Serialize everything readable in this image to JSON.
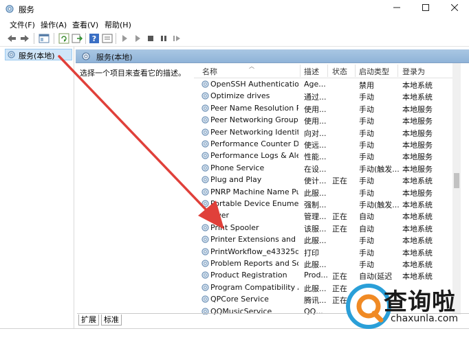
{
  "window": {
    "title": "服务"
  },
  "menu": [
    "文件(F)",
    "操作(A)",
    "查看(V)",
    "帮助(H)"
  ],
  "tree": {
    "root_label": "服务(本地)"
  },
  "panel": {
    "header": "服务(本地)",
    "description_prompt": "选择一个项目来查看它的描述。"
  },
  "columns": [
    "名称",
    "描述",
    "状态",
    "启动类型",
    "登录为"
  ],
  "services": [
    {
      "name": "OpenSSH Authentication ...",
      "desc": "Age...",
      "status": "",
      "startup": "禁用",
      "logon": "本地系统"
    },
    {
      "name": "Optimize drives",
      "desc": "通过...",
      "status": "",
      "startup": "手动",
      "logon": "本地系统"
    },
    {
      "name": "Peer Name Resolution Pr...",
      "desc": "使用...",
      "status": "",
      "startup": "手动",
      "logon": "本地服务"
    },
    {
      "name": "Peer Networking Groupi",
      "desc": "使用...",
      "status": "",
      "startup": "手动",
      "logon": "本地服务"
    },
    {
      "name": "Peer Networking Identity...",
      "desc": "向对...",
      "status": "",
      "startup": "手动",
      "logon": "本地服务"
    },
    {
      "name": "Performance Counter DL...",
      "desc": "使远...",
      "status": "",
      "startup": "手动",
      "logon": "本地服务"
    },
    {
      "name": "Performance Logs & Aler",
      "desc": "性能...",
      "status": "",
      "startup": "手动",
      "logon": "本地服务"
    },
    {
      "name": "Phone Service",
      "desc": "在设...",
      "status": "",
      "startup": "手动(触发...",
      "logon": "本地服务"
    },
    {
      "name": "Plug and Play",
      "desc": "使计...",
      "status": "正在",
      "startup": "手动",
      "logon": "本地系统"
    },
    {
      "name": "PNRP Machine Name Pu...",
      "desc": "此服...",
      "status": "",
      "startup": "手动",
      "logon": "本地服务"
    },
    {
      "name": "Portable Device Enumera...",
      "desc": "强制...",
      "status": "",
      "startup": "手动(触发...",
      "logon": "本地系统"
    },
    {
      "name": "ower",
      "desc": "管理...",
      "status": "正在",
      "startup": "自动",
      "logon": "本地系统"
    },
    {
      "name": "Print Spooler",
      "desc": "该服...",
      "status": "正在",
      "startup": "自动",
      "logon": "本地系统"
    },
    {
      "name": "Printer Extensions and N...",
      "desc": "此服...",
      "status": "",
      "startup": "手动",
      "logon": "本地系统"
    },
    {
      "name": "PrintWorkflow_e43325d",
      "desc": "打印",
      "status": "",
      "startup": "手动",
      "logon": "本地系统"
    },
    {
      "name": "Problem Reports and Sol...",
      "desc": "此服...",
      "status": "",
      "startup": "手动",
      "logon": "本地系统"
    },
    {
      "name": "Product Registration",
      "desc": "Prod...",
      "status": "正在",
      "startup": "自动(延迟",
      "logon": "本地系统"
    },
    {
      "name": "Program Compatibility A...",
      "desc": "此服...",
      "status": "正在",
      "startup": "",
      "logon": ""
    },
    {
      "name": "QPCore Service",
      "desc": "腾讯...",
      "status": "正在",
      "startup": "",
      "logon": ""
    },
    {
      "name": "QQMusicService",
      "desc": "QQ...",
      "status": "",
      "startup": "",
      "logon": ""
    }
  ],
  "tabs": [
    "扩展",
    "标准"
  ],
  "watermark": {
    "brand": "查询啦",
    "domain": "chaxunla.com"
  },
  "colors": {
    "header_band": "#8fb3d8",
    "selection": "#cfe5f8",
    "arrow": "#e0403a",
    "logo_blue": "#2a9fd8"
  }
}
